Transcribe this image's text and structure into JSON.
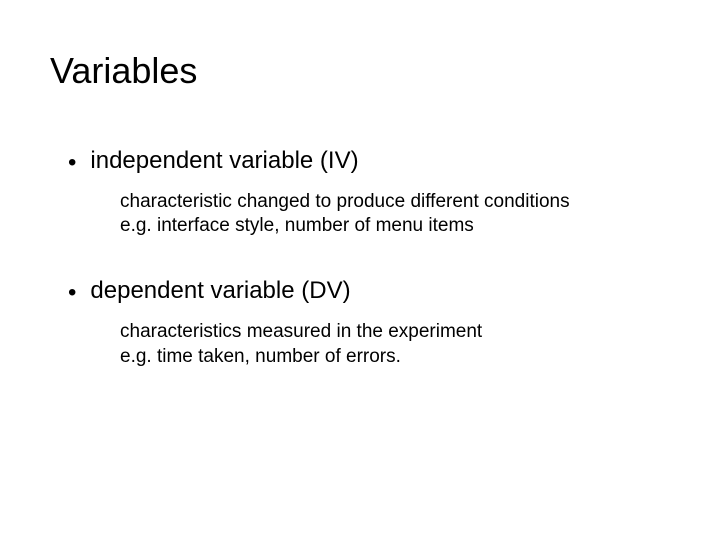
{
  "title": "Variables",
  "items": [
    {
      "heading": "independent variable (IV)",
      "desc_line1": "characteristic changed to produce different conditions",
      "desc_line2": "e.g. interface style, number of menu items"
    },
    {
      "heading": "dependent variable (DV)",
      "desc_line1": "characteristics measured in the experiment",
      "desc_line2": "e.g. time taken, number of errors."
    }
  ]
}
